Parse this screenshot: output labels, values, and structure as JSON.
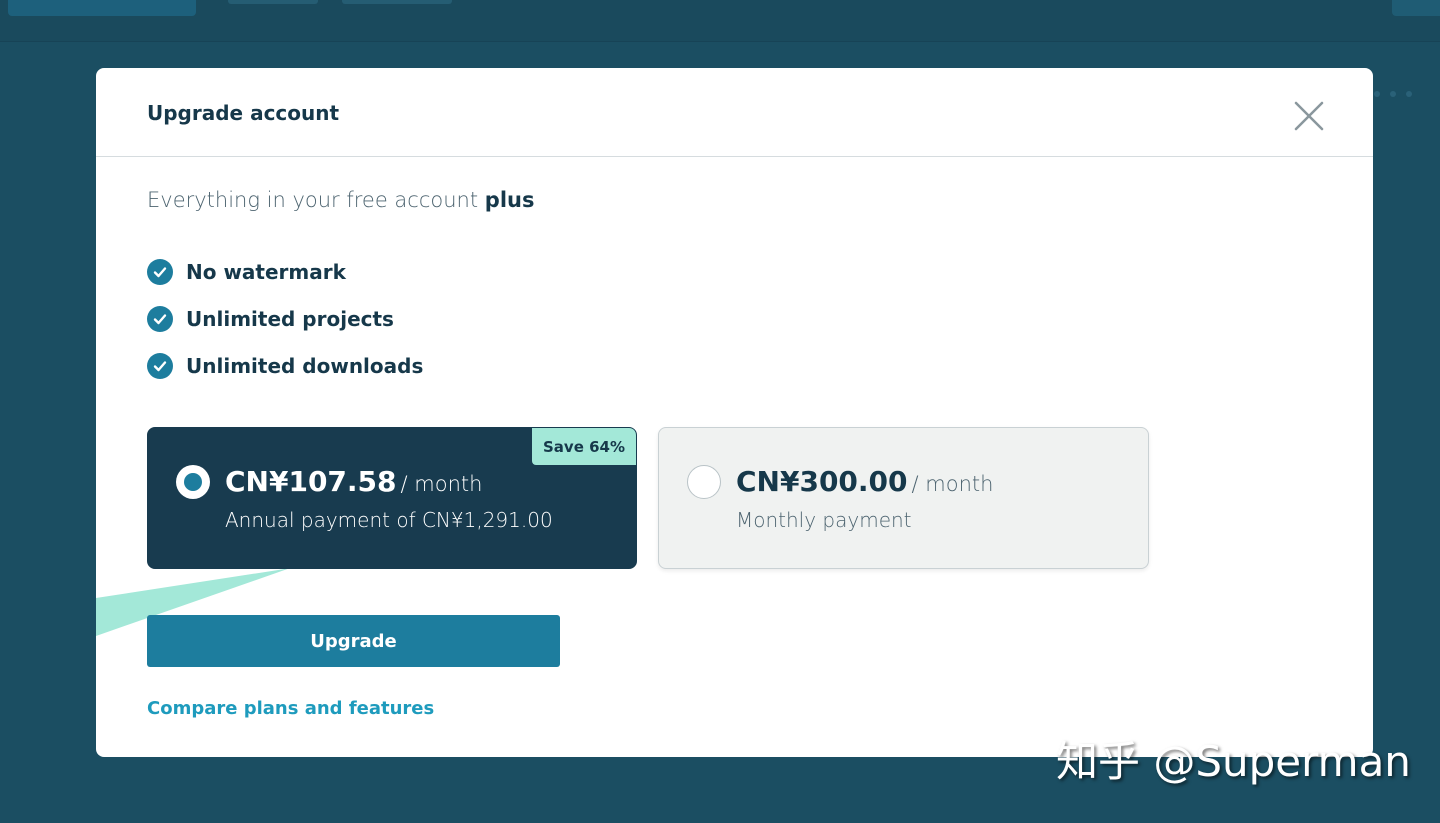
{
  "modal": {
    "title": "Upgrade account",
    "close_icon": "close-icon"
  },
  "intro": {
    "text": "Everything in your free account ",
    "emphasis": "plus"
  },
  "features": [
    {
      "label": "No watermark",
      "icon": "check-circle-icon"
    },
    {
      "label": "Unlimited projects",
      "icon": "check-circle-icon"
    },
    {
      "label": "Unlimited downloads",
      "icon": "check-circle-icon"
    }
  ],
  "plans": {
    "annual": {
      "price": "CN¥107.58",
      "period": "/ month",
      "description": "Annual payment of CN¥1,291.00",
      "badge": "Save 64%",
      "selected": true
    },
    "monthly": {
      "price": "CN¥300.00",
      "period": "/ month",
      "description": "Monthly payment",
      "selected": false
    }
  },
  "actions": {
    "upgrade_label": "Upgrade",
    "compare_label": "Compare plans and features"
  },
  "watermark": "知乎 @Superman",
  "colors": {
    "backdrop": "#1b4e62",
    "primary": "#1d7d9e",
    "dark_card": "#183b4f",
    "badge": "#a3e8d8",
    "link": "#1e9bbd",
    "text": "#16384a"
  }
}
